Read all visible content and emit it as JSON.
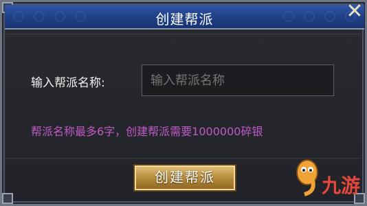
{
  "dialog": {
    "title": "创建帮派",
    "close_icon": "close-icon"
  },
  "form": {
    "name_label": "输入帮派名称:",
    "name_input": {
      "value": "",
      "placeholder": "输入帮派名称"
    },
    "hint": "帮派名称最多6字，创建帮派需要1000000碎银"
  },
  "actions": {
    "create_label": "创建帮派"
  },
  "watermark": {
    "logo_icon": "9you-mascot-icon",
    "text": "九游"
  },
  "colors": {
    "title_bar": "#1f3f86",
    "hint_text": "#c05ac8",
    "button_gold": "#b48838",
    "background": "#25262b"
  }
}
